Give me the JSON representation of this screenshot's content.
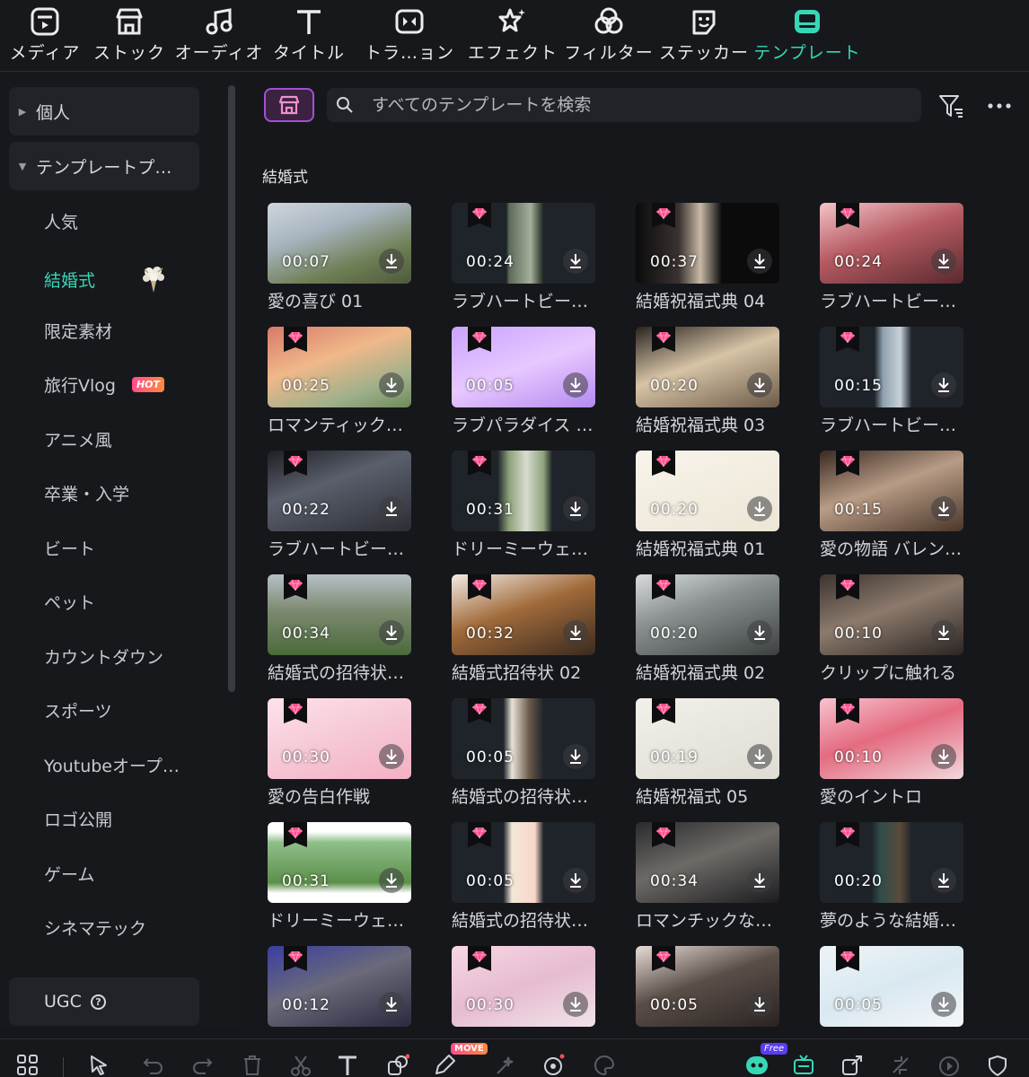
{
  "top_tabs": [
    {
      "label": "メディア",
      "icon": "media-icon"
    },
    {
      "label": "ストック",
      "icon": "stock-icon"
    },
    {
      "label": "オーディオ",
      "icon": "audio-icon"
    },
    {
      "label": "タイトル",
      "icon": "title-icon"
    },
    {
      "label": "トラ…ョン",
      "icon": "transition-icon"
    },
    {
      "label": "エフェクト",
      "icon": "effect-icon"
    },
    {
      "label": "フィルター",
      "icon": "filter-icon"
    },
    {
      "label": "ステッカー",
      "icon": "sticker-icon"
    },
    {
      "label": "テンプレート",
      "icon": "template-icon",
      "active": true
    }
  ],
  "sidebar": {
    "groups": [
      {
        "label": "個人",
        "expanded": false
      },
      {
        "label": "テンプレートプ…",
        "expanded": true
      }
    ],
    "items": [
      {
        "label": "人気"
      },
      {
        "label": "結婚式",
        "active": true
      },
      {
        "label": "限定素材"
      },
      {
        "label": "旅行Vlog",
        "badge": "HOT"
      },
      {
        "label": "アニメ風"
      },
      {
        "label": "卒業・入学"
      },
      {
        "label": "ビート"
      },
      {
        "label": "ペット"
      },
      {
        "label": "カウントダウン"
      },
      {
        "label": "スポーツ"
      },
      {
        "label": "Youtubeオープ…"
      },
      {
        "label": "ロゴ公開"
      },
      {
        "label": "ゲーム"
      },
      {
        "label": "シネマテック"
      }
    ],
    "ugc_label": "UGC"
  },
  "search": {
    "placeholder": "すべてのテンプレートを検索"
  },
  "section_title": "結婚式",
  "templates": [
    {
      "name": "愛の喜び 01",
      "duration": "00:07",
      "premium": false
    },
    {
      "name": "ラブハートビー…",
      "duration": "00:24",
      "premium": true
    },
    {
      "name": "結婚祝福式典 04",
      "duration": "00:37",
      "premium": true
    },
    {
      "name": "ラブハートビー…",
      "duration": "00:24",
      "premium": true
    },
    {
      "name": "ロマンティック…",
      "duration": "00:25",
      "premium": true
    },
    {
      "name": "ラブパラダイス …",
      "duration": "00:05",
      "premium": true
    },
    {
      "name": "結婚祝福式典 03",
      "duration": "00:20",
      "premium": true
    },
    {
      "name": "ラブハートビー…",
      "duration": "00:15",
      "premium": true
    },
    {
      "name": "ラブハートビー…",
      "duration": "00:22",
      "premium": true
    },
    {
      "name": "ドリーミーウェ…",
      "duration": "00:31",
      "premium": true
    },
    {
      "name": "結婚祝福式典 01",
      "duration": "00:20",
      "premium": true
    },
    {
      "name": "愛の物語 バレン…",
      "duration": "00:15",
      "premium": true
    },
    {
      "name": "結婚式の招待状…",
      "duration": "00:34",
      "premium": true
    },
    {
      "name": "結婚式招待状 02",
      "duration": "00:32",
      "premium": true
    },
    {
      "name": "結婚祝福式典 02",
      "duration": "00:20",
      "premium": true
    },
    {
      "name": "クリップに触れる",
      "duration": "00:10",
      "premium": true
    },
    {
      "name": "愛の告白作戦",
      "duration": "00:30",
      "premium": true
    },
    {
      "name": "結婚式の招待状…",
      "duration": "00:05",
      "premium": true
    },
    {
      "name": "結婚祝福式 05",
      "duration": "00:19",
      "premium": true
    },
    {
      "name": "愛のイントロ",
      "duration": "00:10",
      "premium": true
    },
    {
      "name": "ドリーミーウェ…",
      "duration": "00:31",
      "premium": true
    },
    {
      "name": "結婚式の招待状…",
      "duration": "00:05",
      "premium": true
    },
    {
      "name": "ロマンチックな…",
      "duration": "00:34",
      "premium": true
    },
    {
      "name": "夢のような結婚…",
      "duration": "00:20",
      "premium": true
    },
    {
      "name": "",
      "duration": "00:12",
      "premium": true
    },
    {
      "name": "",
      "duration": "00:30",
      "premium": true
    },
    {
      "name": "",
      "duration": "00:05",
      "premium": true
    },
    {
      "name": "",
      "duration": "00:05",
      "premium": true
    }
  ],
  "bottom_badges": {
    "move": "MOVE",
    "free": "Free"
  },
  "colors": {
    "accent": "#36d7b7",
    "background": "#16171b",
    "panel": "#222328",
    "premium_gem": "#ff4d8d"
  }
}
